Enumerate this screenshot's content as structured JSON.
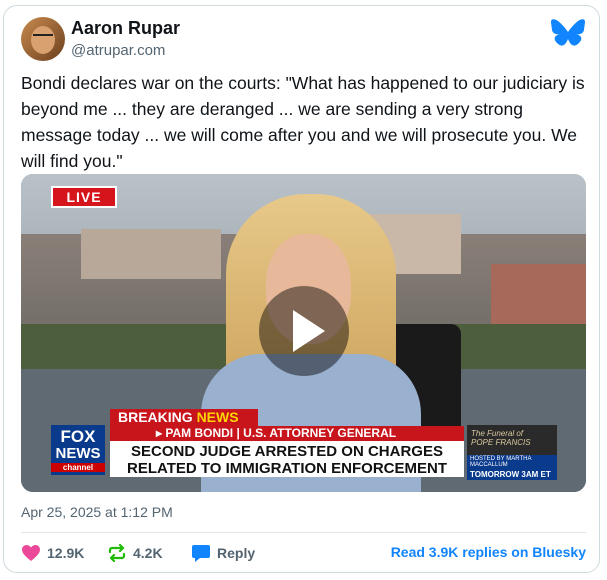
{
  "author": {
    "name": "Aaron Rupar",
    "handle": "@atrupar.com"
  },
  "post": {
    "text": "Bondi declares war on the courts: \"What has happened to our judiciary is beyond me ... they are deranged ... we are sending a very strong message today ... we will come after you and we will prosecute you. We will find you.\"",
    "timestamp": "Apr 25, 2025 at 1:12 PM"
  },
  "video": {
    "live_label": "LIVE",
    "breaking_label_1": "BREAKING",
    "breaking_label_2": "NEWS",
    "subline": "▸ PAM BONDI | U.S. ATTORNEY GENERAL",
    "headline_1": "SECOND JUDGE ARRESTED ON CHARGES",
    "headline_2": "RELATED TO IMMIGRATION ENFORCEMENT",
    "network_1": "FOX",
    "network_2": "NEWS",
    "network_3": "channel",
    "promo_title_1": "The Funeral of",
    "promo_title_2": "POPE FRANCIS",
    "promo_host": "HOSTED BY MARTHA MACCALLUM",
    "promo_time": "TOMORROW 3AM ET"
  },
  "actions": {
    "likes": "12.9K",
    "reposts": "4.2K",
    "reply_label": "Reply",
    "read_replies": "Read 3.9K replies on Bluesky"
  },
  "colors": {
    "accent": "#1185fe",
    "like": "#ec4899",
    "repost": "#20bc07"
  },
  "icons": [
    "butterfly-logo-icon",
    "heart-icon",
    "repost-icon",
    "reply-icon",
    "play-icon"
  ]
}
